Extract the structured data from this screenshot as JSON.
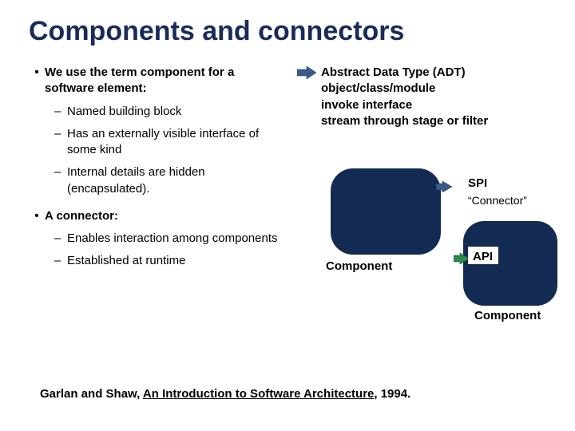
{
  "title": "Components and connectors",
  "left": {
    "item1": {
      "lead": "We use the term ",
      "strong": "component",
      "tail": " for a software element:",
      "subs": [
        "Named building block",
        "Has an externally visible interface of some kind",
        "Internal details are hidden (encapsulated)."
      ]
    },
    "item2": {
      "text": "A connector:",
      "subs": [
        "Enables interaction among components",
        "Established at runtime"
      ]
    }
  },
  "right": {
    "adt": [
      "Abstract Data Type (ADT)",
      "object/class/module",
      "invoke interface",
      "stream through stage or filter"
    ],
    "spi": "SPI",
    "connector": "“Connector”",
    "api": "API",
    "component": "Component"
  },
  "citation": {
    "authors": "Garlan and Shaw, ",
    "title": "An Introduction to Software Architecture",
    "year": ", 1994."
  },
  "colors": {
    "title": "#1a2a5a",
    "shape": "#132a52",
    "arrow_fill": "#3a5a8a",
    "arrow_green": "#2a8a4a"
  }
}
